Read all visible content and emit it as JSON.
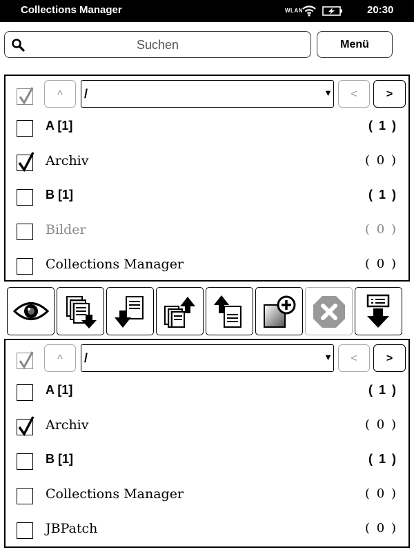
{
  "status": {
    "app_title": "Collections Manager",
    "wlan": "WLAN",
    "time": "20:30"
  },
  "search": {
    "placeholder": "Suchen",
    "menu_label": "Menü"
  },
  "top_panel": {
    "path": "/",
    "up_label": "^",
    "prev_label": "<",
    "next_label": ">",
    "items": [
      {
        "name": "A [1]",
        "count": "( 1 )",
        "checked": false,
        "bold": true,
        "gray": false
      },
      {
        "name": "Archiv",
        "count": "( 0 )",
        "checked": true,
        "bold": false,
        "gray": false
      },
      {
        "name": "B [1]",
        "count": "( 1 )",
        "checked": false,
        "bold": true,
        "gray": false
      },
      {
        "name": "Bilder",
        "count": "( 0 )",
        "checked": false,
        "bold": false,
        "gray": true
      },
      {
        "name": "Collections Manager",
        "count": "( 0 )",
        "checked": false,
        "bold": false,
        "gray": false
      }
    ]
  },
  "toolbar": {
    "buttons": [
      {
        "icon": "eye-icon",
        "enabled": true
      },
      {
        "icon": "copy-down-icon",
        "enabled": true
      },
      {
        "icon": "move-down-icon",
        "enabled": true
      },
      {
        "icon": "copy-up-icon",
        "enabled": true
      },
      {
        "icon": "move-up-icon",
        "enabled": true
      },
      {
        "icon": "add-collection-icon",
        "enabled": true
      },
      {
        "icon": "delete-icon",
        "enabled": false
      },
      {
        "icon": "export-icon",
        "enabled": true
      }
    ]
  },
  "bottom_panel": {
    "path": "/",
    "up_label": "^",
    "prev_label": "<",
    "next_label": ">",
    "items": [
      {
        "name": "A [1]",
        "count": "( 1 )",
        "checked": false,
        "bold": true,
        "gray": false
      },
      {
        "name": "Archiv",
        "count": "( 0 )",
        "checked": true,
        "bold": false,
        "gray": false
      },
      {
        "name": "B [1]",
        "count": "( 1 )",
        "checked": false,
        "bold": true,
        "gray": false
      },
      {
        "name": "Collections Manager",
        "count": "( 0 )",
        "checked": false,
        "bold": false,
        "gray": false
      },
      {
        "name": "JBPatch",
        "count": "( 0 )",
        "checked": false,
        "bold": false,
        "gray": false
      }
    ]
  }
}
